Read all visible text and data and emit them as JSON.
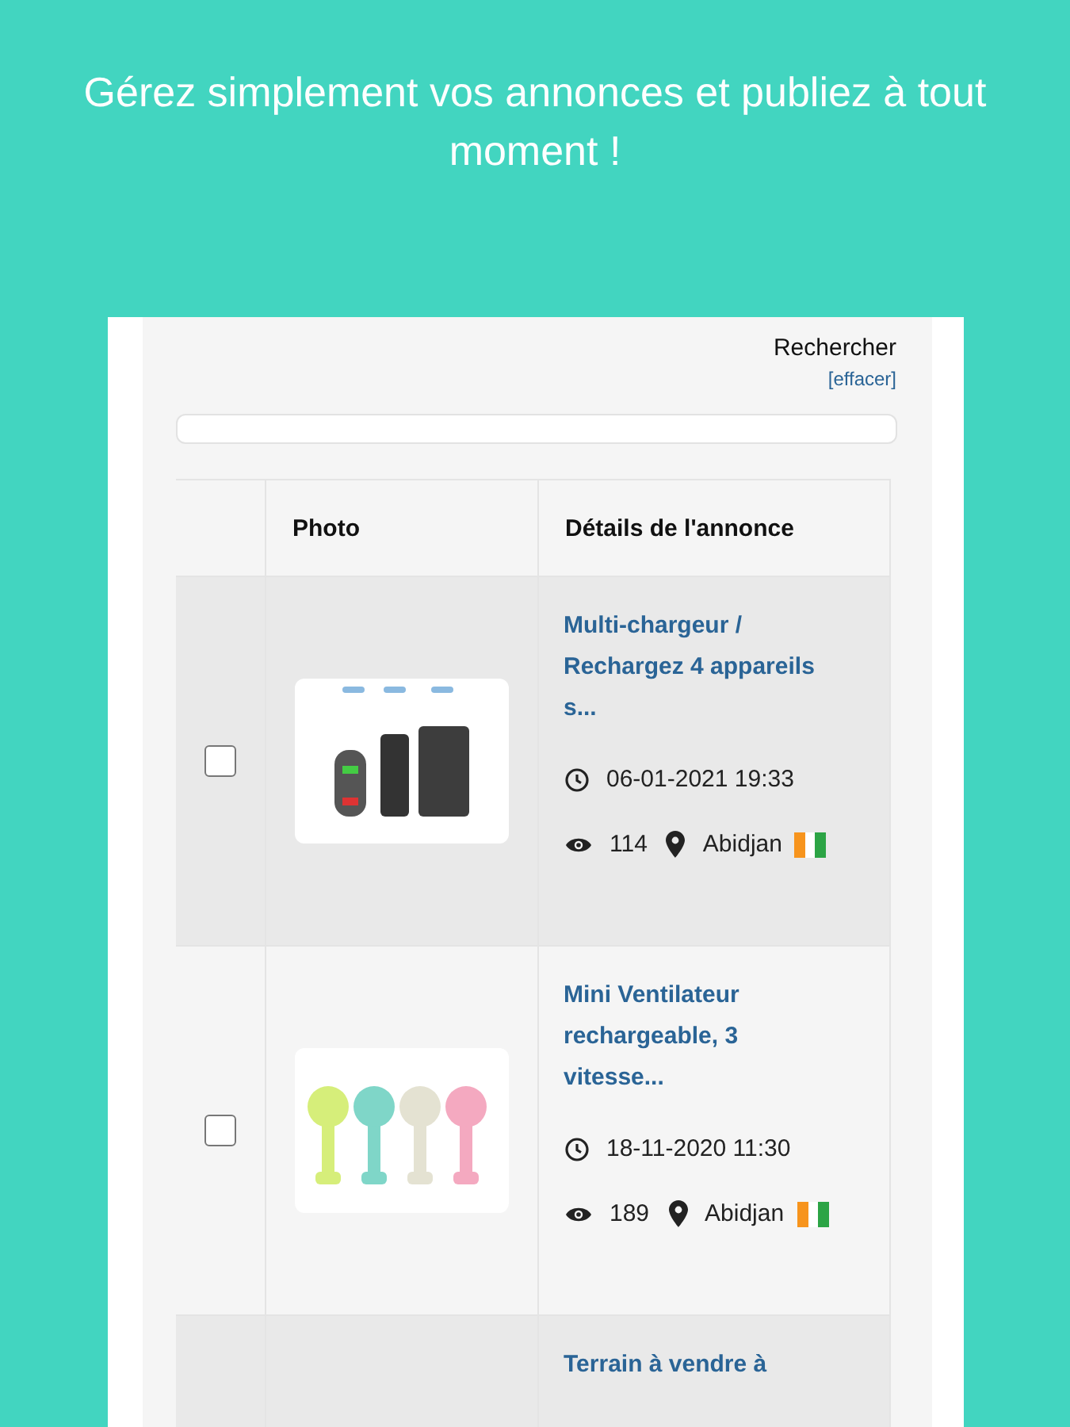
{
  "headline": "Gérez simplement vos annonces et publiez à tout moment !",
  "search": {
    "label": "Rechercher",
    "clear_link": "[effacer]"
  },
  "table": {
    "columns": [
      "Photo",
      "Détails de l'annonce"
    ],
    "rows": [
      {
        "checked": false,
        "title": "Multi-chargeur / Rechargez 4 appareils s...",
        "date": "06-01-2021 19:33",
        "views": "114",
        "city": "Abidjan"
      },
      {
        "checked": false,
        "title": "Mini Ventilateur rechargeable, 3 vitesse...",
        "date": "18-11-2020 11:30",
        "views": "189",
        "city": "Abidjan"
      },
      {
        "title": "Terrain à vendre à"
      }
    ]
  }
}
